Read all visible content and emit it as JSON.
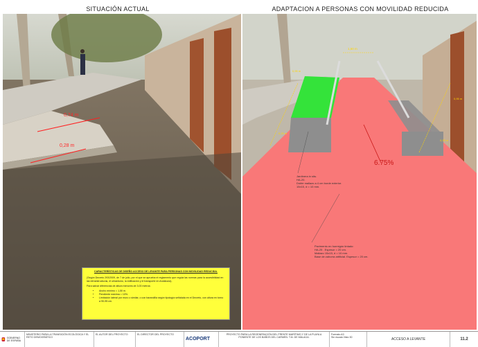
{
  "panels": {
    "left_title": "SITUACIÓN ACTUAL",
    "right_title": "ADAPTACION A PERSONAS CON MOVILIDAD REDUCIDA"
  },
  "left_photo": {
    "measure_1": "0,74 m",
    "measure_2": "0,28 m"
  },
  "right_photo": {
    "width_label": "1,50 m",
    "slope_label": "6.75%",
    "dim_left_1": "0,95 m",
    "dim_left_2": "0,25 m",
    "dim_right_1": "0,95 m",
    "dim_right_2": "0,25 m",
    "colors": {
      "ramp": "#f97878",
      "planter": "#34e33a",
      "gravel": "#8e8e8e",
      "rail": "#dcdcdc"
    },
    "callout_1": [
      "Jardinera in situ.",
      "HA-20.",
      "Doble mallazo a 4 cm borde exterior.",
      "15x15, d = 10 mm."
    ],
    "callout_2": [
      "Pavimento en hormigón tintado:",
      "HA-25 . Espesor = 20 cm.",
      "Mallazo 15x15, d = 10 mm.",
      "Base de zahorra artificial. Espesor = 20 cm."
    ]
  },
  "design_box": {
    "heading": "CARACTERÍSTICAS DE DISEÑO ACCESO DE LEVANTE PARA PERSONAS CON MOVILIDAD REDUCIDA.",
    "intro": "(Según Decreto 293/2009, de 7 de julio, por el que se aprueba el reglamento que regula las normas para la accesibilidad en las infraestructuras, el urbanismo, la edificación y el transporte en Andalucía).",
    "lead": "Para salvar diferencias de altura menores de 3,00 metros:",
    "items": [
      "Ancho mínimo = 1,50 m.",
      "Pendiente máxima = 10%.",
      "Limitación lateral por muro o similar, o con barandilla según tipología señalada en el Decreto, con altura en torno a 90-95 cm."
    ]
  },
  "title_block": {
    "ministry": "MINISTERIO PARA LA TRANSICIÓN ECOLÓGICA Y EL RETO DEMOGRÁFICO",
    "gov": "GOBIERNO DE ESPAÑA",
    "author_label": "EL AUTOR DEL PROYECTO",
    "director_label": "EL DIRECTOR DEL PROYECTO",
    "company": "ACOPORT",
    "project": "PROYECTO PARA LA REGENERACIÓN DEL FRENTE MARÍTIMO Y DE LA PLAYA A PONIENTE DE LOS BAÑOS DEL CARMEN. T.M. DE MÁLAGA.",
    "format": "Formato A3",
    "scale": "Sin escala  Visto 30",
    "plan_title": "ACCESO A LEVANTE",
    "sheet_no": "11.2"
  }
}
